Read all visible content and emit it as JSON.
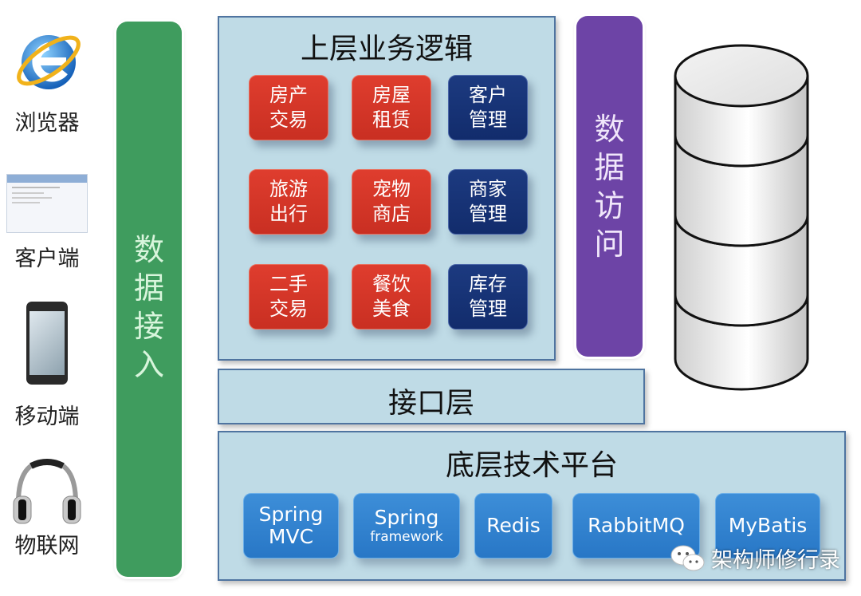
{
  "clients": [
    {
      "label": "浏览器",
      "icon": "ie-browser-icon"
    },
    {
      "label": "客户端",
      "icon": "desktop-client-icon"
    },
    {
      "label": "移动端",
      "icon": "smartphone-icon"
    },
    {
      "label": "物联网",
      "icon": "headphones-icon"
    }
  ],
  "data_access_in": {
    "label": "数据接入",
    "color": "#3f9c5e"
  },
  "business_logic": {
    "title": "上层业务逻辑",
    "modules": [
      {
        "line1": "房产",
        "line2": "交易",
        "color": "red"
      },
      {
        "line1": "房屋",
        "line2": "租赁",
        "color": "red"
      },
      {
        "line1": "客户",
        "line2": "管理",
        "color": "blue"
      },
      {
        "line1": "旅游",
        "line2": "出行",
        "color": "red"
      },
      {
        "line1": "宠物",
        "line2": "商店",
        "color": "red"
      },
      {
        "line1": "商家",
        "line2": "管理",
        "color": "blue"
      },
      {
        "line1": "二手",
        "line2": "交易",
        "color": "red"
      },
      {
        "line1": "餐饮",
        "line2": "美食",
        "color": "red"
      },
      {
        "line1": "库存",
        "line2": "管理",
        "color": "blue"
      }
    ]
  },
  "data_access": {
    "label": "数据访问",
    "color": "#6d44a6"
  },
  "database": {
    "icon": "database-cylinder-icon",
    "segments": 4
  },
  "interface_layer": {
    "title": "接口层"
  },
  "platform": {
    "title": "底层技术平台",
    "techs": [
      {
        "line1": "Spring",
        "line2": "MVC",
        "small": false
      },
      {
        "line1": "Spring",
        "line2": "framework",
        "small": true
      },
      {
        "line1": "Redis",
        "line2": "",
        "small": false
      },
      {
        "line1": "RabbitMQ",
        "line2": "",
        "small": false
      },
      {
        "line1": "MyBatis",
        "line2": "",
        "small": false
      }
    ]
  },
  "watermark": {
    "text": "架构师修行录",
    "icon": "wechat-icon"
  },
  "colors": {
    "red_tile": "#d3372a",
    "navy_tile": "#163374",
    "tech_blue": "#2f80cf",
    "panel_bg": "#bfdbe6",
    "panel_border": "#4f74a0"
  }
}
